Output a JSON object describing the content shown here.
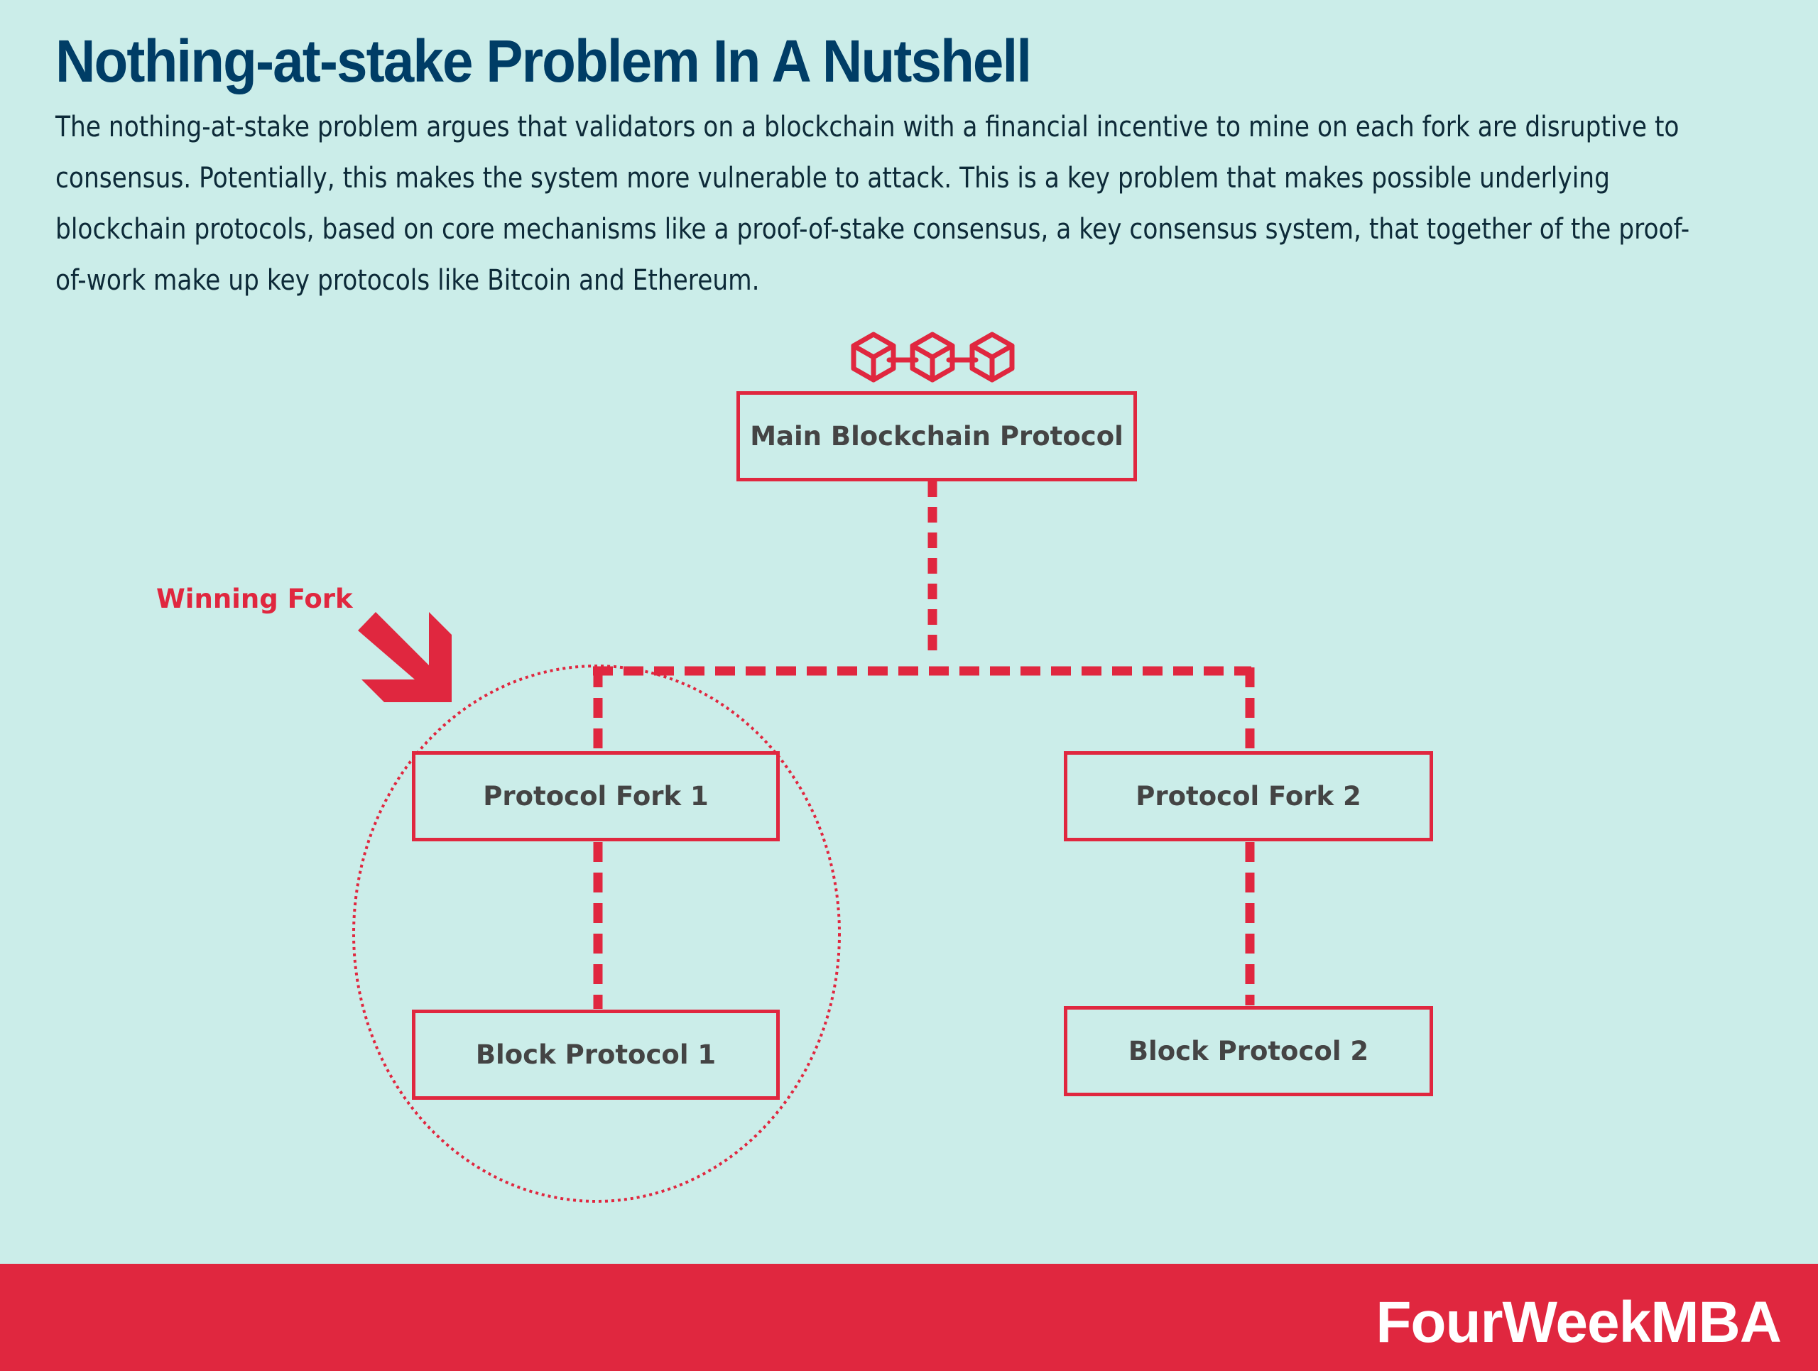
{
  "header": {
    "title": "Nothing-at-stake Problem In A Nutshell",
    "description": "The nothing-at-stake problem argues that validators on a blockchain with a financial incentive to mine on each fork are disruptive to consensus. Potentially, this makes the system more vulnerable to attack. This is a key problem that makes possible underlying blockchain protocols, based on core mechanisms like a proof-of-stake consensus, a key consensus system, that together of the proof-of-work make up key protocols like Bitcoin and Ethereum."
  },
  "diagram": {
    "icon": "blockchain-icon",
    "nodes": {
      "main": "Main Blockchain Protocol",
      "fork1": "Protocol Fork 1",
      "fork2": "Protocol Fork 2",
      "block1": "Block Protocol 1",
      "block2": "Block Protocol 2"
    },
    "edges": [
      [
        "main",
        "fork1"
      ],
      [
        "main",
        "fork2"
      ],
      [
        "fork1",
        "block1"
      ],
      [
        "fork2",
        "block2"
      ]
    ],
    "annotation": {
      "label": "Winning Fork",
      "icon": "arrow-down-right-icon",
      "highlights": [
        "fork1",
        "block1"
      ]
    }
  },
  "footer": {
    "brand": "FourWeekMBA"
  },
  "colors": {
    "background": "#cbede9",
    "title": "#003d66",
    "accent": "#e0273f",
    "node_text": "#444444",
    "brand_text": "#ffffff"
  }
}
